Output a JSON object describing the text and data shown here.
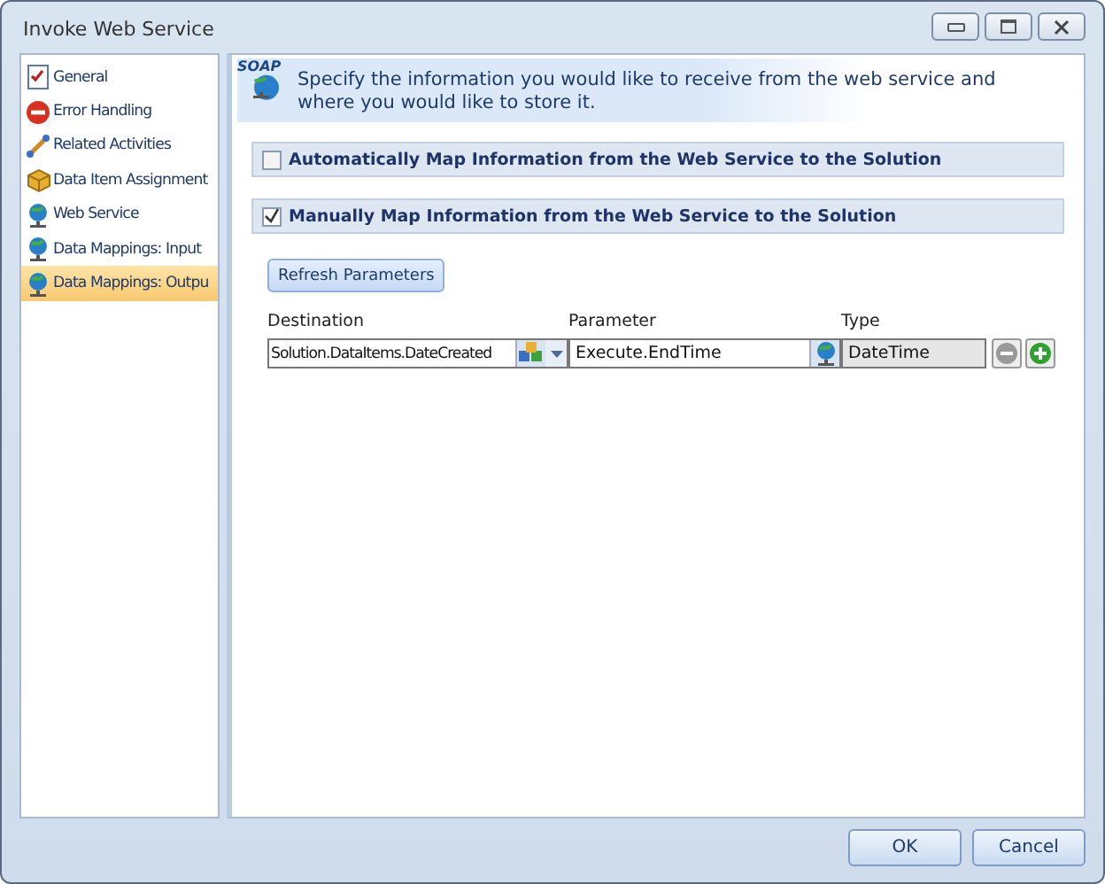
{
  "window": {
    "title": "Invoke Web Service"
  },
  "sidebar": {
    "items": [
      {
        "label": "General",
        "selected": false
      },
      {
        "label": "Error Handling",
        "selected": false
      },
      {
        "label": "Related Activities",
        "selected": false
      },
      {
        "label": "Data Item Assignment",
        "selected": false
      },
      {
        "label": "Web Service",
        "selected": false
      },
      {
        "label": "Data Mappings: Input",
        "selected": false
      },
      {
        "label": "Data Mappings: Outpu",
        "selected": true
      }
    ]
  },
  "header": {
    "icon_text": "SOAP",
    "text": "Specify the information you would like to receive from the web service and where you would like to store it."
  },
  "options": [
    {
      "label": "Automatically Map Information from the Web Service to the Solution",
      "checked": false
    },
    {
      "label": "Manually Map Information from the Web Service to the Solution",
      "checked": true
    }
  ],
  "refresh_button": "Refresh Parameters",
  "mappings": {
    "columns": [
      "Destination",
      "Parameter",
      "Type"
    ],
    "rows": [
      {
        "destination": "Solution.DataItems.DateCreated",
        "parameter": "Execute.EndTime",
        "type": "DateTime"
      }
    ]
  },
  "buttons": [
    "OK",
    "Cancel"
  ]
}
